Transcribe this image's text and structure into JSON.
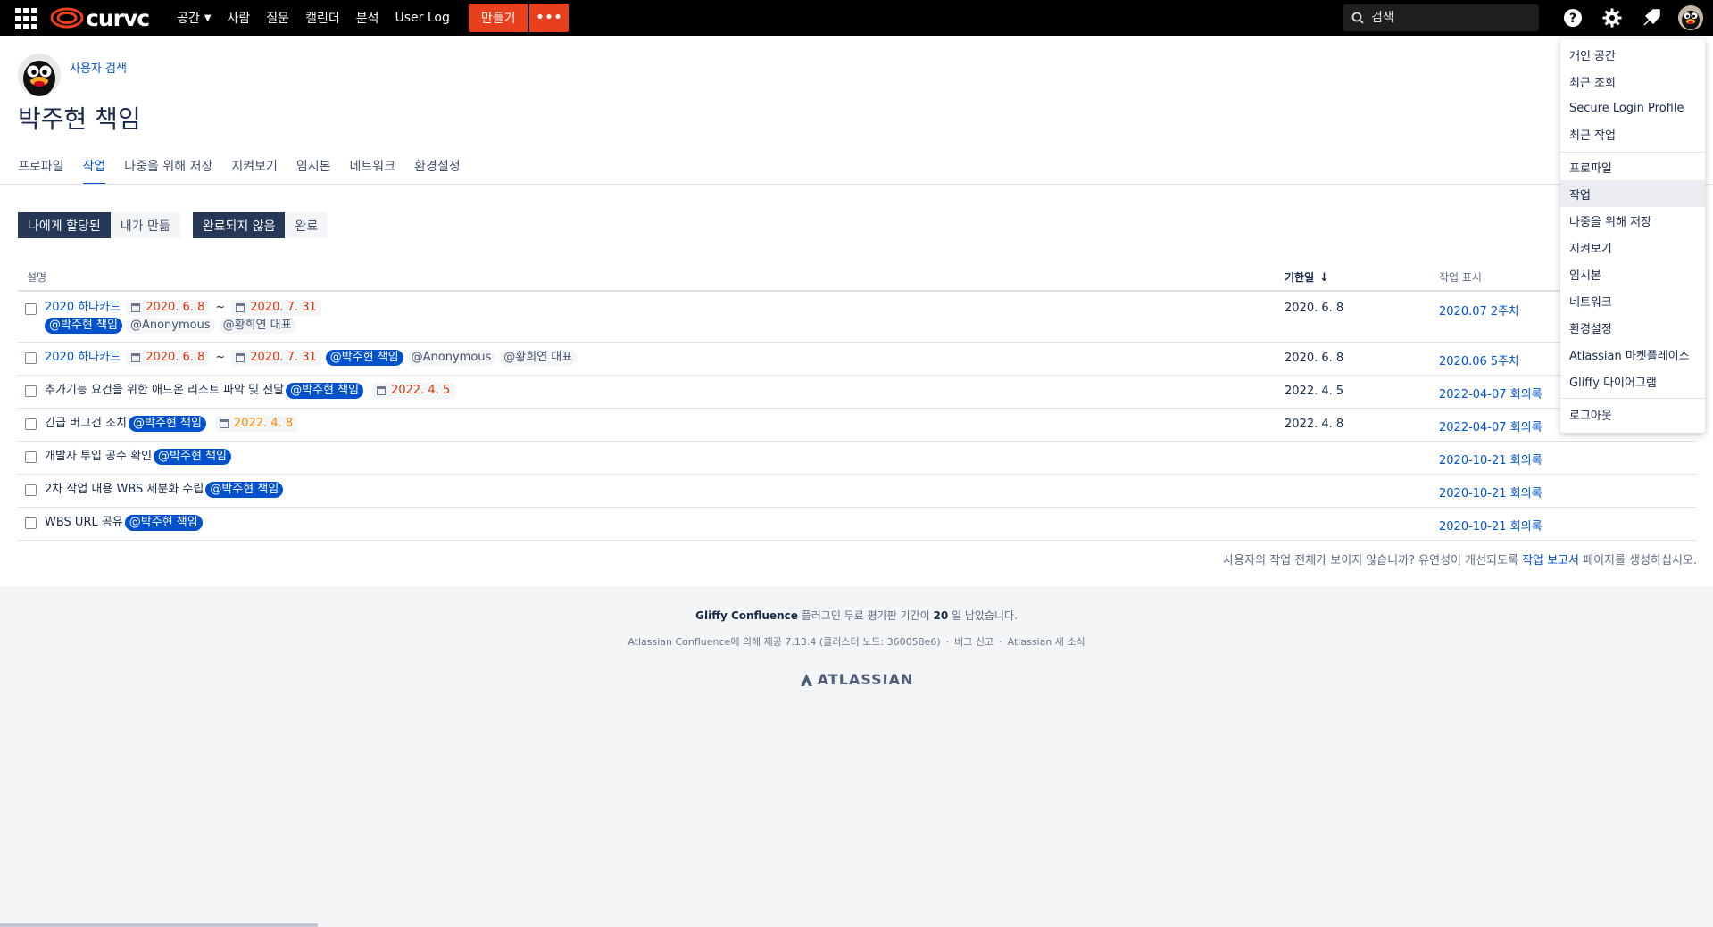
{
  "topbar": {
    "logo_text": "curvc",
    "nav": [
      {
        "label": "공간",
        "has_caret": true
      },
      {
        "label": "사람"
      },
      {
        "label": "질문"
      },
      {
        "label": "캘린더"
      },
      {
        "label": "분석"
      },
      {
        "label": "User Log"
      }
    ],
    "create_label": "만들기",
    "more_label": "•••",
    "search_placeholder": "검색",
    "icons": [
      "help-icon",
      "gear-icon",
      "notification-icon",
      "user-avatar"
    ]
  },
  "profile": {
    "user_search_link": "사용자 검색",
    "title": "박주현 책임"
  },
  "tabs": [
    {
      "label": "프로파일",
      "active": false
    },
    {
      "label": "작업",
      "active": true
    },
    {
      "label": "나중을 위해 저장",
      "active": false
    },
    {
      "label": "지켜보기",
      "active": false
    },
    {
      "label": "임시본",
      "active": false
    },
    {
      "label": "네트워크",
      "active": false
    },
    {
      "label": "환경설정",
      "active": false
    }
  ],
  "filters": {
    "assignee": [
      {
        "label": "나에게 할당된",
        "selected": true
      },
      {
        "label": "내가 만듦",
        "selected": false
      }
    ],
    "status": [
      {
        "label": "완료되지 않음",
        "selected": true
      },
      {
        "label": "완료",
        "selected": false
      }
    ]
  },
  "table": {
    "headers": {
      "description": "설명",
      "due": "기한일",
      "location": "작업 표시"
    },
    "rows": [
      {
        "link": "2020 하나카드",
        "date_from": "2020. 6. 8",
        "date_to": "2020. 7. 31",
        "mention_me": "@박주현 책임",
        "mention1": "@Anonymous",
        "mention2": "@황희연 대표",
        "due": "2020. 6. 8",
        "location": "2020.07 2주차"
      },
      {
        "link": "2020 하나카드",
        "date_from": "2020. 6. 8",
        "date_to": "2020. 7. 31",
        "mention_me": "@박주현 책임",
        "mention1": "@Anonymous",
        "mention2": "@황희연 대표",
        "due": "2020. 6. 8",
        "location": "2020.06 5주차"
      },
      {
        "text": "추가기능 요건을 위한 애드온 리스트 파악 및 전달",
        "mention_me": "@박주현 책임",
        "date": "2022. 4. 5",
        "due": "2022. 4. 5",
        "location": "2022-04-07 회의록"
      },
      {
        "text": "긴급 버그건 조치",
        "mention_me": "@박주현 책임",
        "date": "2022. 4. 8",
        "due": "2022. 4. 8",
        "location": "2022-04-07 회의록"
      },
      {
        "text": "개발자 투입 공수 확인",
        "mention_me": "@박주현 책임",
        "due": "",
        "location": "2020-10-21 회의록"
      },
      {
        "text": "2차 작업 내용 WBS 세분화 수립",
        "mention_me": "@박주현 책임",
        "due": "",
        "location": "2020-10-21 회의록"
      },
      {
        "text": "WBS URL 공유",
        "mention_me": "@박주현 책임",
        "due": "",
        "location": "2020-10-21 회의록"
      }
    ]
  },
  "report_hint": {
    "before": "사용자의 작업 전체가 보이지 않습니까? 유연성이 개선되도록 ",
    "link": "작업 보고서",
    "after": " 페이지를 생성하십시오."
  },
  "footer": {
    "plugin_name": "Gliffy Confluence",
    "plugin_mid": " 플러그인 무료 평가판 기간이 ",
    "plugin_days": "20",
    "plugin_end": " 일 남았습니다.",
    "powered": "Atlassian Confluence에 의해 제공 7.13.4 (클러스터 노드: 360058e6)",
    "sep": "·",
    "bug": "버그 신고",
    "news": "Atlassian 새 소식",
    "brand": "ATLASSIAN"
  },
  "dropdown": {
    "groups": [
      [
        "개인 공간",
        "최근 조회",
        "Secure Login Profile",
        "최근 작업"
      ],
      [
        "프로파일",
        "작업",
        "나중을 위해 저장",
        "지켜보기",
        "임시본",
        "네트워크",
        "환경설정",
        "Atlassian 마켓플레이스",
        "Gliffy 다이어그램"
      ],
      [
        "로그아웃"
      ]
    ],
    "active": "작업"
  },
  "colors": {
    "topbar_bg": "#000000",
    "accent_create": "#e8401c",
    "link": "#0052cc",
    "filter_selected": "#253858",
    "date_overdue": "#de350b",
    "date_soon": "#ff8b00",
    "footer_bg": "#f4f5f7"
  }
}
